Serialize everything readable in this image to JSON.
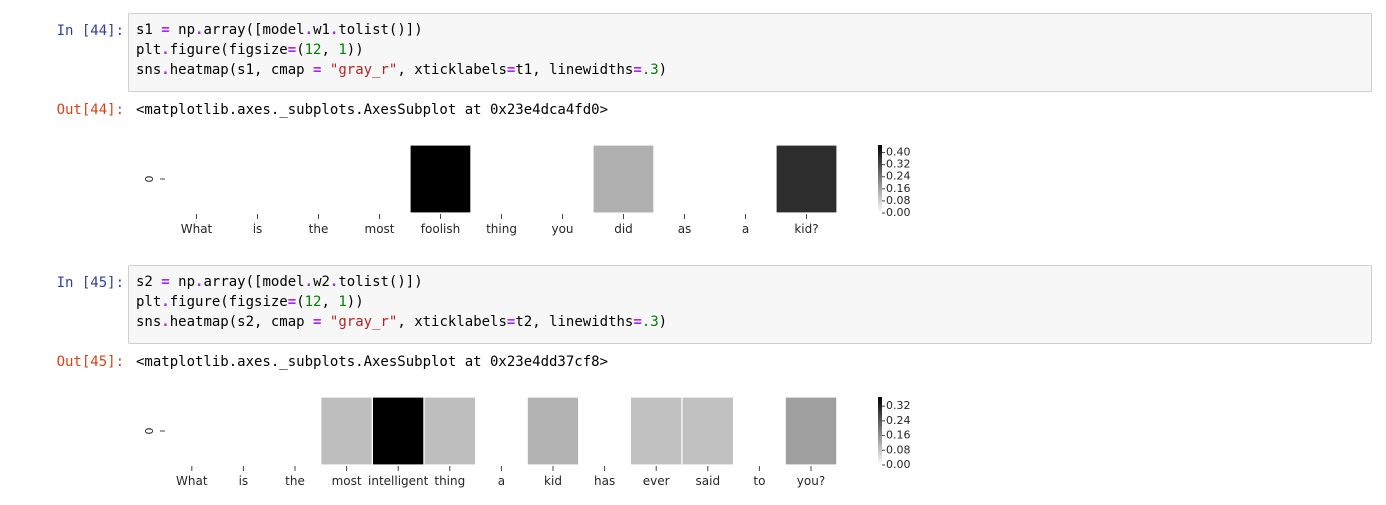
{
  "cells": [
    {
      "in_prompt": "In [44]:",
      "code_lines": [
        [
          {
            "t": "s1 ",
            "c": ""
          },
          {
            "t": "=",
            "c": "op"
          },
          {
            "t": " np",
            "c": ""
          },
          {
            "t": ".",
            "c": "op"
          },
          {
            "t": "array([model",
            "c": ""
          },
          {
            "t": ".",
            "c": "op"
          },
          {
            "t": "w1",
            "c": ""
          },
          {
            "t": ".",
            "c": "op"
          },
          {
            "t": "tolist()])",
            "c": ""
          }
        ],
        [
          {
            "t": "plt",
            "c": ""
          },
          {
            "t": ".",
            "c": "op"
          },
          {
            "t": "figure(figsize",
            "c": ""
          },
          {
            "t": "=",
            "c": "op"
          },
          {
            "t": "(",
            "c": ""
          },
          {
            "t": "12",
            "c": "num"
          },
          {
            "t": ", ",
            "c": ""
          },
          {
            "t": "1",
            "c": "num"
          },
          {
            "t": "))",
            "c": ""
          }
        ],
        [
          {
            "t": "sns",
            "c": ""
          },
          {
            "t": ".",
            "c": "op"
          },
          {
            "t": "heatmap(s1, cmap ",
            "c": ""
          },
          {
            "t": "=",
            "c": "op"
          },
          {
            "t": " ",
            "c": ""
          },
          {
            "t": "\"gray_r\"",
            "c": "str"
          },
          {
            "t": ", xticklabels",
            "c": ""
          },
          {
            "t": "=",
            "c": "op"
          },
          {
            "t": "t1, linewidths",
            "c": ""
          },
          {
            "t": "=",
            "c": "op"
          },
          {
            "t": ".3",
            "c": "num"
          },
          {
            "t": ")",
            "c": ""
          }
        ]
      ],
      "out_prompt": "Out[44]:",
      "out_text": "<matplotlib.axes._subplots.AxesSubplot at 0x23e4dca4fd0>"
    },
    {
      "in_prompt": "In [45]:",
      "code_lines": [
        [
          {
            "t": "s2 ",
            "c": ""
          },
          {
            "t": "=",
            "c": "op"
          },
          {
            "t": " np",
            "c": ""
          },
          {
            "t": ".",
            "c": "op"
          },
          {
            "t": "array([model",
            "c": ""
          },
          {
            "t": ".",
            "c": "op"
          },
          {
            "t": "w2",
            "c": ""
          },
          {
            "t": ".",
            "c": "op"
          },
          {
            "t": "tolist()])",
            "c": ""
          }
        ],
        [
          {
            "t": "plt",
            "c": ""
          },
          {
            "t": ".",
            "c": "op"
          },
          {
            "t": "figure(figsize",
            "c": ""
          },
          {
            "t": "=",
            "c": "op"
          },
          {
            "t": "(",
            "c": ""
          },
          {
            "t": "12",
            "c": "num"
          },
          {
            "t": ", ",
            "c": ""
          },
          {
            "t": "1",
            "c": "num"
          },
          {
            "t": "))",
            "c": ""
          }
        ],
        [
          {
            "t": "sns",
            "c": ""
          },
          {
            "t": ".",
            "c": "op"
          },
          {
            "t": "heatmap(s2, cmap ",
            "c": ""
          },
          {
            "t": "=",
            "c": "op"
          },
          {
            "t": " ",
            "c": ""
          },
          {
            "t": "\"gray_r\"",
            "c": "str"
          },
          {
            "t": ", xticklabels",
            "c": ""
          },
          {
            "t": "=",
            "c": "op"
          },
          {
            "t": "t2, linewidths",
            "c": ""
          },
          {
            "t": "=",
            "c": "op"
          },
          {
            "t": ".3",
            "c": "num"
          },
          {
            "t": ")",
            "c": ""
          }
        ]
      ],
      "out_prompt": "Out[45]:",
      "out_text": "<matplotlib.axes._subplots.AxesSubplot at 0x23e4dd37cf8>"
    }
  ],
  "chart_data": [
    {
      "type": "heatmap",
      "title": "",
      "xlabel": "",
      "ylabel": "",
      "cmap": "gray_r",
      "ytick_labels": [
        "0"
      ],
      "x": [
        "What",
        "is",
        "the",
        "most",
        "foolish",
        "thing",
        "you",
        "did",
        "as",
        "a",
        "kid?"
      ],
      "values": [
        0,
        0,
        0,
        0,
        0.45,
        0,
        0,
        0.14,
        0,
        0,
        0.37
      ],
      "vmin": 0,
      "vmax": 0.45,
      "colorbar_ticks": [
        0.0,
        0.08,
        0.16,
        0.24,
        0.32,
        0.4
      ],
      "colorbar_tick_labels": [
        "0.00",
        "0.08",
        "0.16",
        "0.24",
        "0.32",
        "0.40"
      ]
    },
    {
      "type": "heatmap",
      "title": "",
      "xlabel": "",
      "ylabel": "",
      "cmap": "gray_r",
      "ytick_labels": [
        "0"
      ],
      "x": [
        "What",
        "is",
        "the",
        "most",
        "intelligent",
        "thing",
        "a",
        "kid",
        "has",
        "ever",
        "said",
        "to",
        "you?"
      ],
      "values": [
        0,
        0,
        0,
        0.095,
        0.37,
        0.095,
        0,
        0.11,
        0,
        0.09,
        0.09,
        0,
        0.14
      ],
      "vmin": 0,
      "vmax": 0.37,
      "colorbar_ticks": [
        0.0,
        0.08,
        0.16,
        0.24,
        0.32
      ],
      "colorbar_tick_labels": [
        "0.00",
        "0.08",
        "0.16",
        "0.24",
        "0.32"
      ]
    }
  ]
}
